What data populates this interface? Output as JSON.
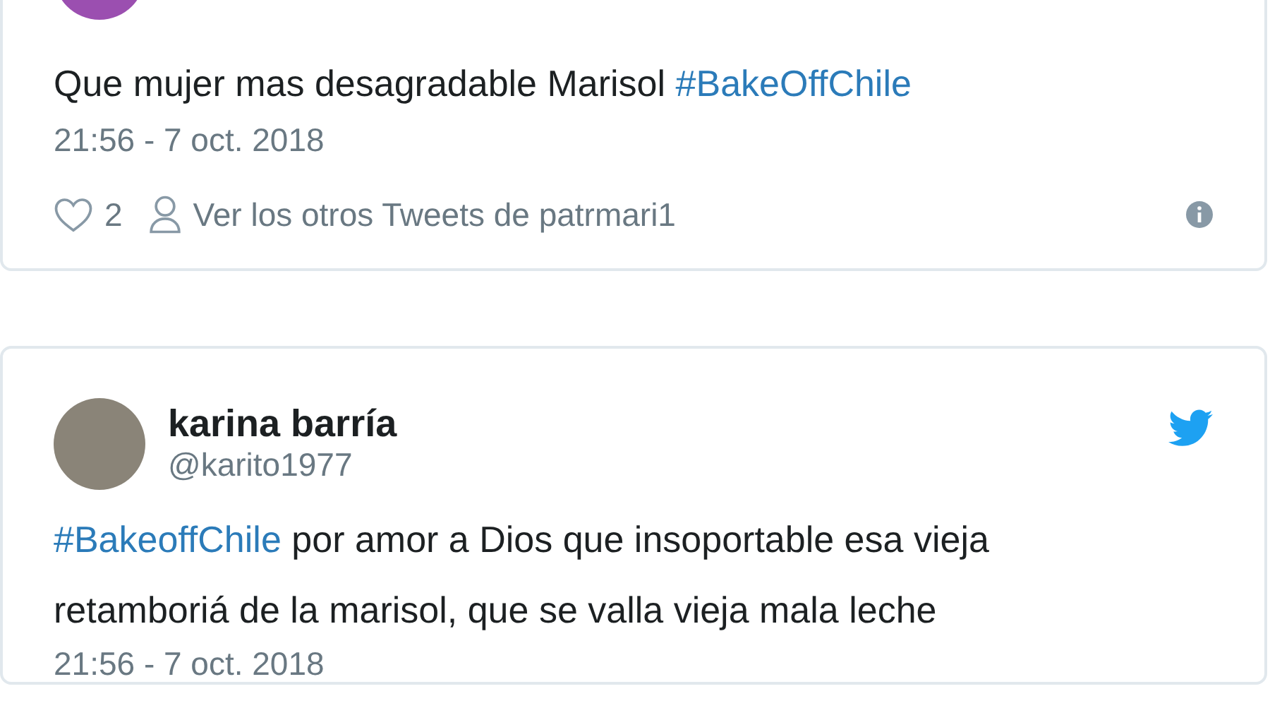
{
  "tweets": [
    {
      "text": [
        {
          "kind": "text",
          "text": "Que mujer mas desagradable Marisol  "
        },
        {
          "kind": "hashtag",
          "text": "#BakeOffChile"
        }
      ],
      "date": "21:56 - 7 oct. 2018",
      "likes": "2",
      "profile_link": "Ver los otros Tweets de patrmari1"
    },
    {
      "name": "karina barría",
      "handle": "@karito1977",
      "text": [
        {
          "kind": "hashtag",
          "text": "#BakeoffChile"
        },
        {
          "kind": "text",
          "text": " por amor a Dios que insoportable esa vieja retamboriá de la marisol, que se valla vieja mala leche"
        }
      ],
      "date": "21:56 - 7 oct. 2018"
    }
  ]
}
